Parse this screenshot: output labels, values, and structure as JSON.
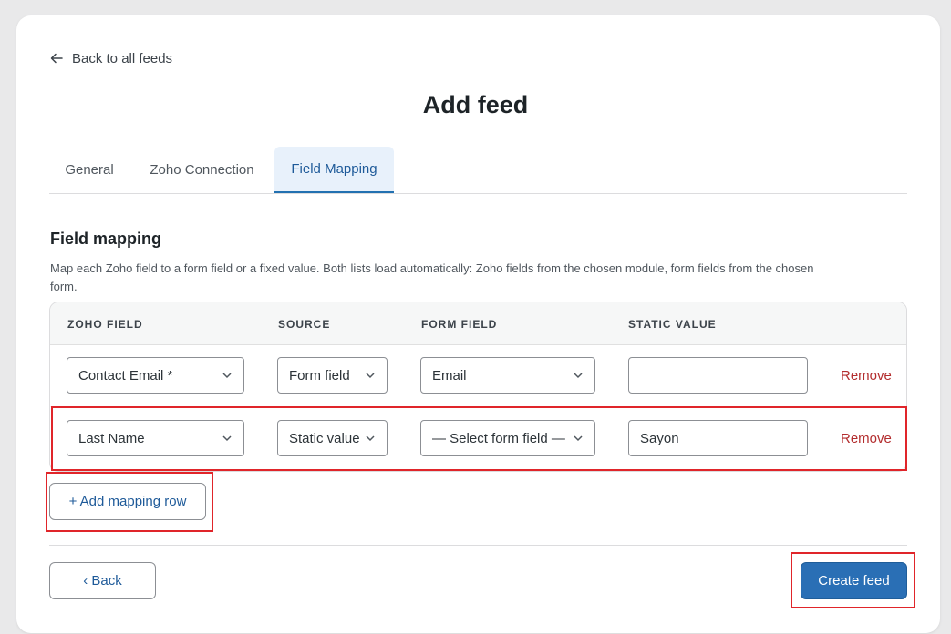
{
  "nav": {
    "back_label": "Back to all feeds"
  },
  "page": {
    "title": "Add feed"
  },
  "tabs": [
    {
      "label": "General",
      "active": false
    },
    {
      "label": "Zoho Connection",
      "active": false
    },
    {
      "label": "Field Mapping",
      "active": true
    }
  ],
  "section": {
    "title": "Field mapping",
    "description": "Map each Zoho field to a form field or a fixed value. Both lists load automatically: Zoho fields from the chosen module, form fields from the chosen form."
  },
  "table": {
    "headers": [
      "ZOHO FIELD",
      "SOURCE",
      "FORM FIELD",
      "STATIC VALUE"
    ],
    "rows": [
      {
        "zoho_field": "Contact Email *",
        "source": "Form field",
        "form_field": "Email",
        "static_value": "",
        "remove_label": "Remove"
      },
      {
        "zoho_field": "Last Name",
        "source": "Static value",
        "form_field": "— Select form field —",
        "static_value": "Sayon",
        "remove_label": "Remove"
      }
    ]
  },
  "actions": {
    "add_row_label": "+ Add mapping row",
    "back_label": "‹ Back",
    "create_label": "Create feed"
  },
  "colors": {
    "accent": "#2a6fb5",
    "tab_active_bg": "#e8f1fb",
    "remove": "#b32d2e",
    "highlight": "#e0252a"
  },
  "icons": {
    "back": "arrow-left-icon",
    "select": "chevron-down-icon"
  }
}
